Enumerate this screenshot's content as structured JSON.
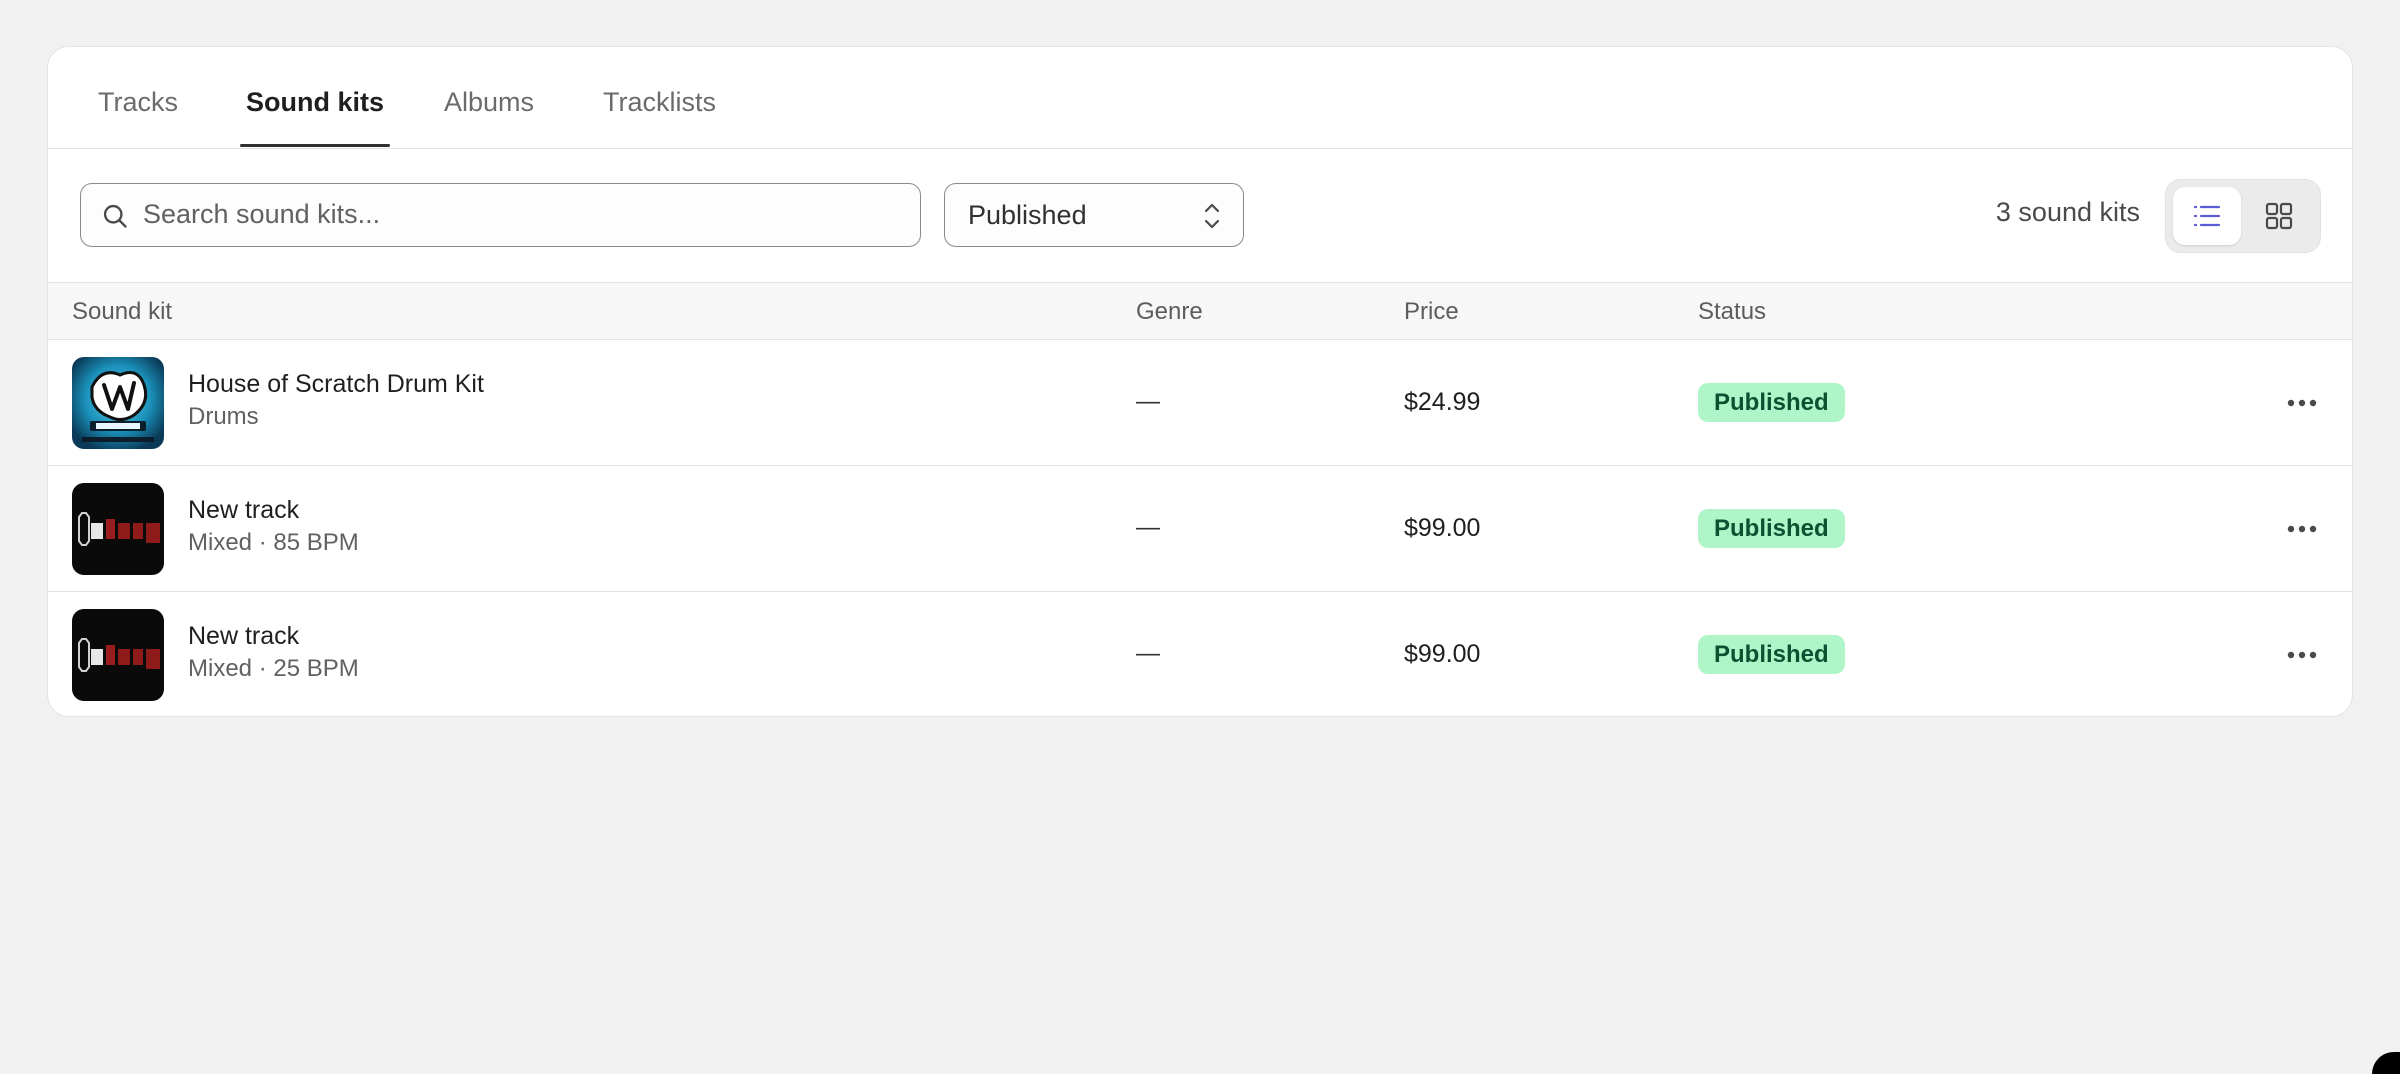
{
  "tabs": [
    {
      "label": "Tracks",
      "active": false
    },
    {
      "label": "Sound kits",
      "active": true
    },
    {
      "label": "Albums",
      "active": false
    },
    {
      "label": "Tracklists",
      "active": false
    }
  ],
  "search": {
    "placeholder": "Search sound kits...",
    "value": ""
  },
  "filter": {
    "selected": "Published"
  },
  "count_label": "3 sound kits",
  "view_toggle": {
    "active": "list",
    "icons": [
      "list-icon",
      "grid-icon"
    ]
  },
  "table": {
    "columns": [
      "Sound kit",
      "Genre",
      "Price",
      "Status"
    ],
    "rows": [
      {
        "title": "House of Scratch Drum Kit",
        "subtitle": "Drums",
        "genre": "—",
        "price": "$24.99",
        "status": "Published",
        "thumb": "house-of-scratch-artwork"
      },
      {
        "title": "New track",
        "subtitle": "Mixed · 85 BPM",
        "genre": "—",
        "price": "$99.00",
        "status": "Published",
        "thumb": "lamorgue-artwork"
      },
      {
        "title": "New track",
        "subtitle": "Mixed · 25 BPM",
        "genre": "—",
        "price": "$99.00",
        "status": "Published",
        "thumb": "lamorgue-artwork"
      }
    ]
  },
  "colors": {
    "accent": "#5b5bd6",
    "badge_bg": "#aff5c7",
    "badge_text": "#0c5132",
    "background": "#f1f1f1"
  }
}
